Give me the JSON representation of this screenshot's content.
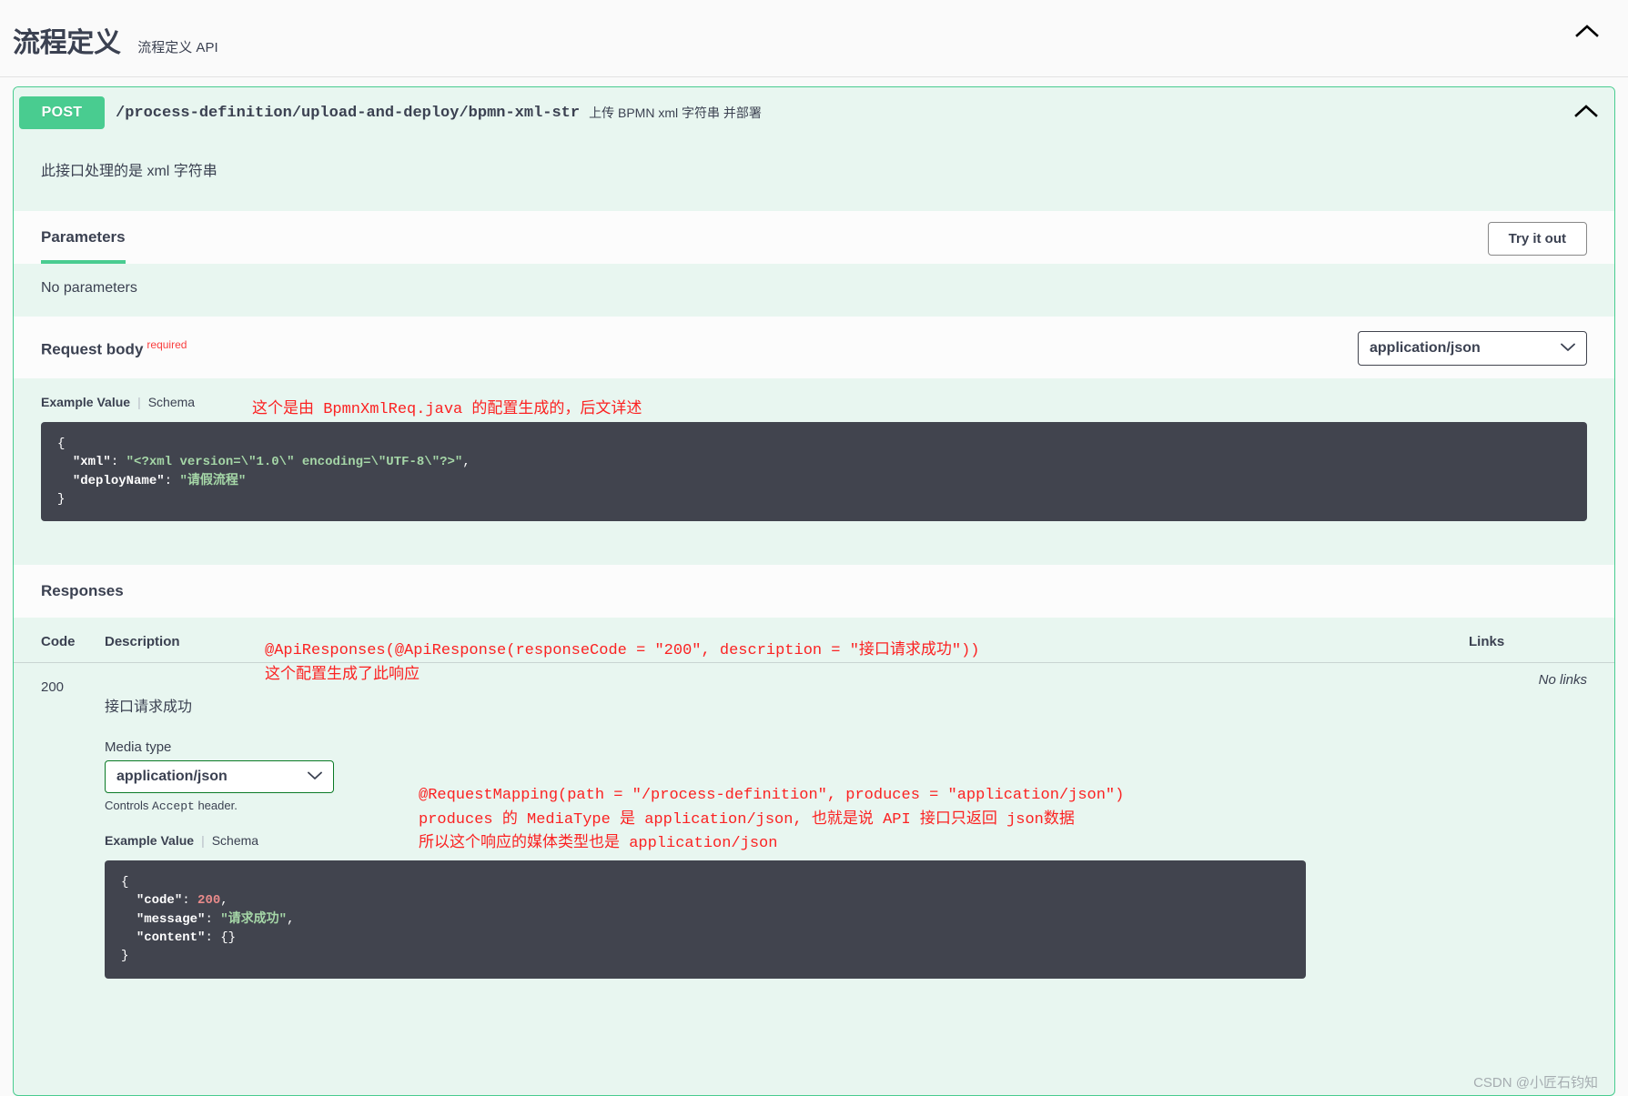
{
  "tag": {
    "title": "流程定义",
    "description": "流程定义 API",
    "collapse_icon": "chevron-up-icon"
  },
  "operation": {
    "method": "POST",
    "path": "/process-definition/upload-and-deploy/bpmn-xml-str",
    "summary": "上传 BPMN xml 字符串 并部署",
    "description": "此接口处理的是 xml 字符串",
    "collapse_icon": "chevron-up-icon"
  },
  "parameters": {
    "tab_label": "Parameters",
    "try_it_out_label": "Try it out",
    "empty_text": "No parameters"
  },
  "request_body": {
    "label": "Request body",
    "required_label": "required",
    "content_type": "application/json",
    "example_tab": "Example Value",
    "schema_tab": "Schema",
    "example_lines": [
      {
        "indent": 0,
        "parts": [
          {
            "t": "{",
            "c": "punct"
          }
        ]
      },
      {
        "indent": 1,
        "parts": [
          {
            "t": "\"xml\"",
            "c": "key"
          },
          {
            "t": ": ",
            "c": "punct"
          },
          {
            "t": "\"<?xml version=\\\"1.0\\\" encoding=\\\"UTF-8\\\"?>\"",
            "c": "str"
          },
          {
            "t": ",",
            "c": "punct"
          }
        ]
      },
      {
        "indent": 1,
        "parts": [
          {
            "t": "\"deployName\"",
            "c": "key"
          },
          {
            "t": ": ",
            "c": "punct"
          },
          {
            "t": "\"请假流程\"",
            "c": "str"
          }
        ]
      },
      {
        "indent": 0,
        "parts": [
          {
            "t": "}",
            "c": "punct"
          }
        ]
      }
    ]
  },
  "responses": {
    "title": "Responses",
    "columns": {
      "code": "Code",
      "description": "Description",
      "links": "Links"
    },
    "rows": [
      {
        "code": "200",
        "description": "接口请求成功",
        "links": "No links",
        "media_type_label": "Media type",
        "media_type_value": "application/json",
        "media_type_hint_prefix": "Controls ",
        "media_type_hint_code": "Accept",
        "media_type_hint_suffix": " header.",
        "example_tab": "Example Value",
        "schema_tab": "Schema",
        "example_lines": [
          {
            "indent": 0,
            "parts": [
              {
                "t": "{",
                "c": "punct"
              }
            ]
          },
          {
            "indent": 1,
            "parts": [
              {
                "t": "\"code\"",
                "c": "key"
              },
              {
                "t": ": ",
                "c": "punct"
              },
              {
                "t": "200",
                "c": "num"
              },
              {
                "t": ",",
                "c": "punct"
              }
            ]
          },
          {
            "indent": 1,
            "parts": [
              {
                "t": "\"message\"",
                "c": "key"
              },
              {
                "t": ": ",
                "c": "punct"
              },
              {
                "t": "\"请求成功\"",
                "c": "str"
              },
              {
                "t": ",",
                "c": "punct"
              }
            ]
          },
          {
            "indent": 1,
            "parts": [
              {
                "t": "\"content\"",
                "c": "key"
              },
              {
                "t": ": ",
                "c": "punct"
              },
              {
                "t": "{}",
                "c": "punct"
              }
            ]
          },
          {
            "indent": 0,
            "parts": [
              {
                "t": "}",
                "c": "punct"
              }
            ]
          }
        ]
      }
    ]
  },
  "annotations": {
    "request_body_note": "这个是由 BpmnXmlReq.java 的配置生成的，后文详述",
    "response_note_line1": "@ApiResponses(@ApiResponse(responseCode = \"200\", description = \"接口请求成功\"))",
    "response_note_line2": "这个配置生成了此响应",
    "media_note_line1": "@RequestMapping(path = \"/process-definition\", produces = \"application/json\")",
    "media_note_line2": "produces 的 MediaType 是 application/json, 也就是说 API 接口只返回 json数据",
    "media_note_line3": "所以这个响应的媒体类型也是 application/json"
  },
  "watermark": "CSDN @小匠石钧知",
  "colors": {
    "method_post": "#49cc90",
    "panel_bg": "#e8f6f0",
    "code_bg": "#41444e",
    "required": "#f93e3e",
    "annotation": "#fb2222"
  }
}
